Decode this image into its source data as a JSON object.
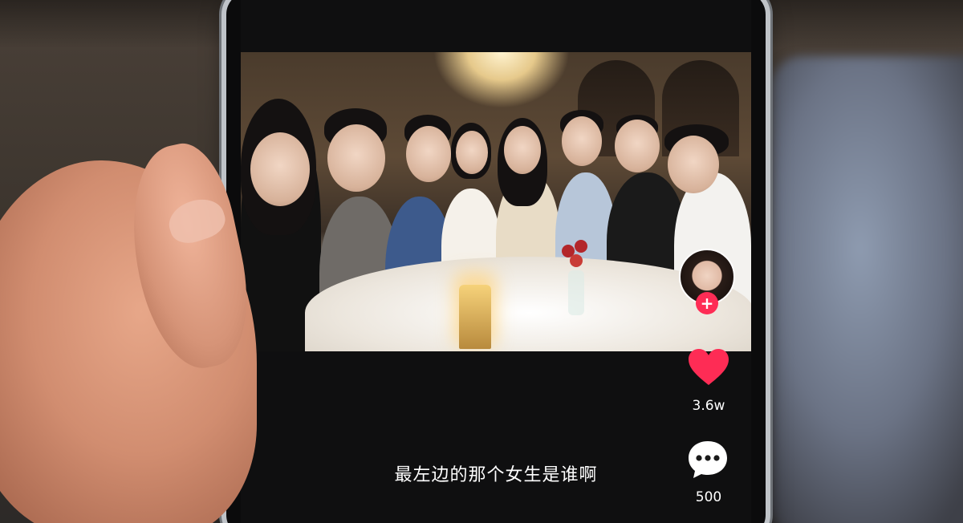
{
  "video": {
    "caption": "最左边的那个女生是谁啊"
  },
  "actions": {
    "follow_symbol": "+",
    "like_count": "3.6w",
    "comment_count": "500",
    "like_icon": "heart-icon",
    "comment_icon": "comment-bubble-icon"
  },
  "colors": {
    "like": "#fe2c55",
    "follow": "#fe2c55",
    "text": "#ffffff",
    "screen_bg": "#0f0f10"
  }
}
